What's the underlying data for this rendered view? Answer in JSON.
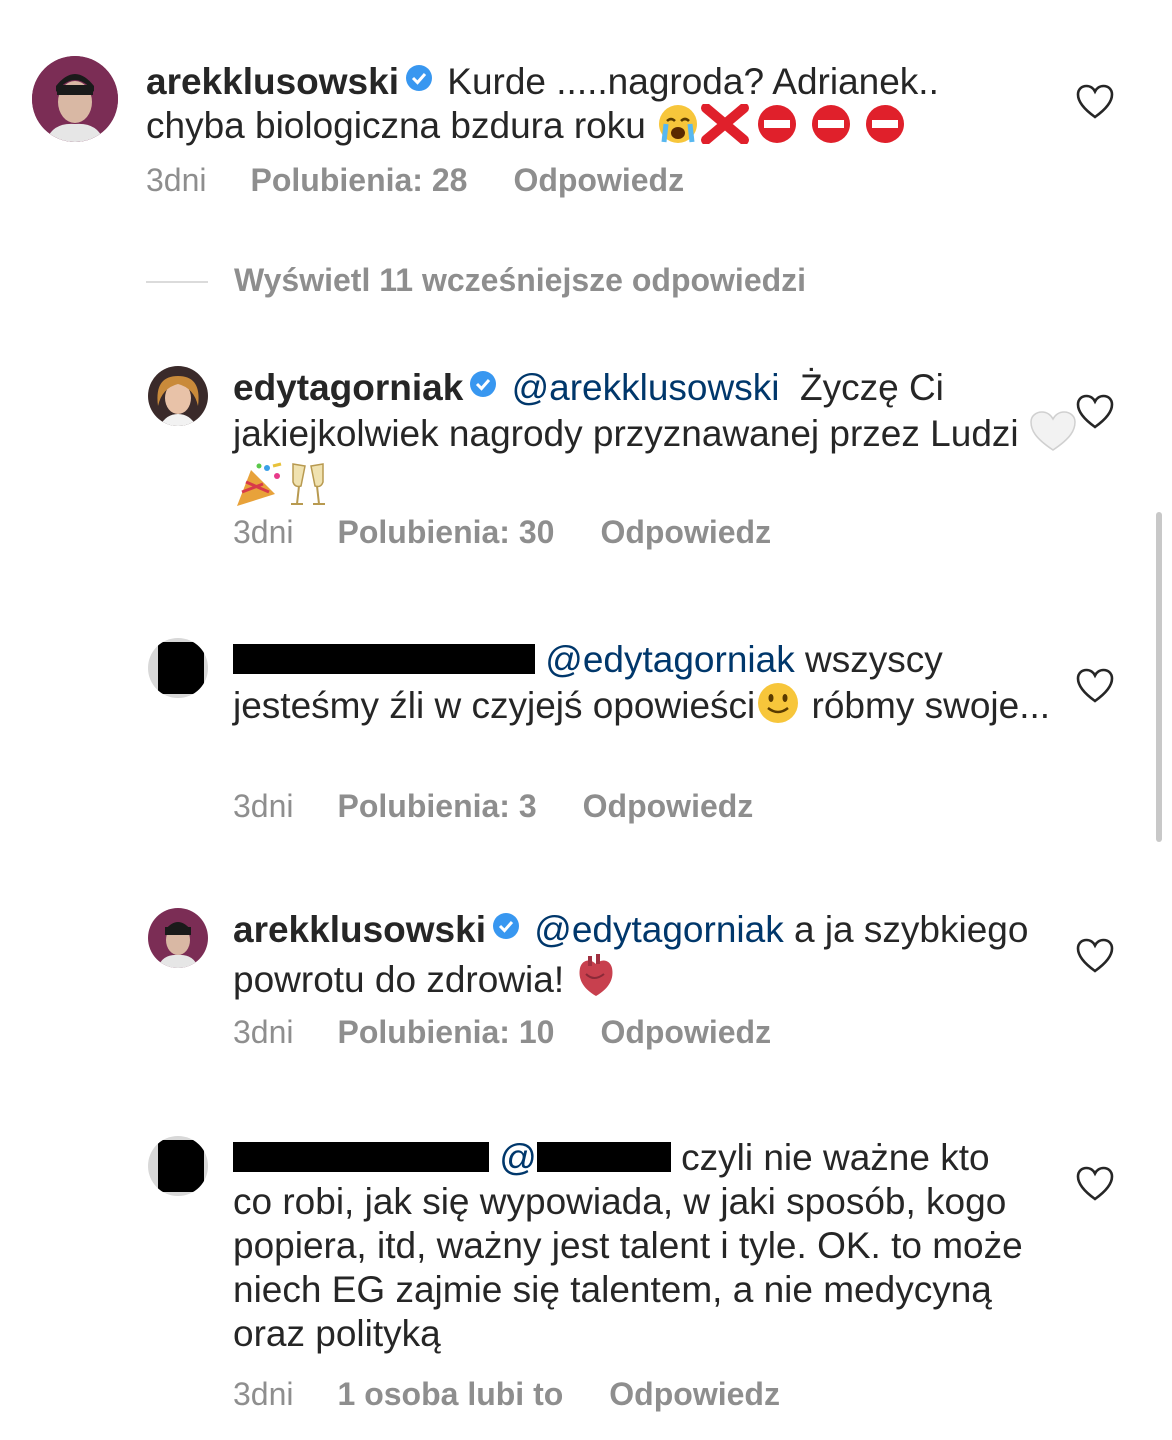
{
  "comments": [
    {
      "user": "arekklusowski",
      "text": "Kurde .....nagroda? Adrianek.. chyba biologiczna bzdura roku",
      "time": "3dni",
      "likes": "Polubienia: 28",
      "reply": "Odpowiedz"
    },
    {
      "user": "edytagorniak",
      "mention": "@arekklusowski",
      "text": "Życzę Ci jakiejkolwiek nagrody przyznawanej przez Ludzi",
      "time": "3dni",
      "likes": "Polubienia: 30",
      "reply": "Odpowiedz"
    },
    {
      "mention": "@edytagorniak",
      "text_a": "wszyscy jesteśmy źli w czyjejś opowieści",
      "text_b": "róbmy swoje...",
      "time": "3dni",
      "likes": "Polubienia: 3",
      "reply": "Odpowiedz"
    },
    {
      "user": "arekklusowski",
      "mention": "@edytagorniak",
      "text": "a ja szybkiego powrotu do zdrowia!",
      "time": "3dni",
      "likes": "Polubienia: 10",
      "reply": "Odpowiedz"
    },
    {
      "mention_prefix": "@",
      "text": "czyli nie ważne kto co robi, jak się wypowiada, w jaki sposób, kogo popiera, itd, ważny jest talent i tyle. OK. to może niech EG zajmie się talentem, a nie medycyną oraz polityką",
      "time": "3dni",
      "likes": "1 osoba lubi to",
      "reply": "Odpowiedz"
    }
  ],
  "view_more": "Wyświetl 11 wcześniejsze odpowiedzi",
  "icons": {
    "verified": "verified-badge-icon",
    "heart": "heart-outline-icon"
  },
  "colors": {
    "mention": "#00376b",
    "secondary": "#8e8e8e",
    "verified": "#3897f0"
  }
}
